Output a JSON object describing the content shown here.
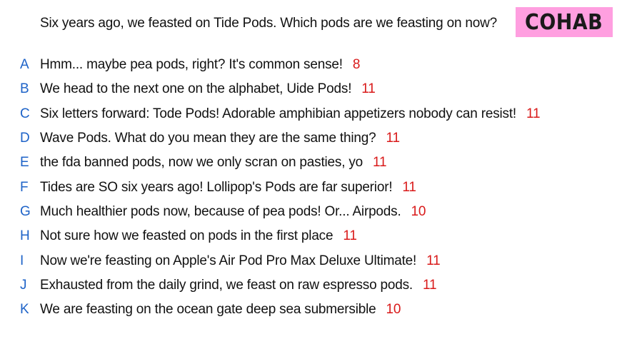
{
  "question": "Six years ago, we feasted on Tide Pods. Which pods are we feasting on now?",
  "logo": "COHAB",
  "colors": {
    "letter": "#1e63c8",
    "score": "#d91a1a",
    "logo_bg": "#ff9fe0"
  },
  "answers": [
    {
      "letter": "A",
      "text": "Hmm... maybe pea pods, right? It's common sense!",
      "score": "8"
    },
    {
      "letter": "B",
      "text": "We head to the next one on the alphabet, Uide Pods!",
      "score": "11"
    },
    {
      "letter": "C",
      "text": "Six letters forward: Tode Pods! Adorable amphibian appetizers nobody can resist!",
      "score": "11"
    },
    {
      "letter": "D",
      "text": "Wave Pods. What do you mean they are the same thing?",
      "score": "11"
    },
    {
      "letter": "E",
      "text": "the fda banned pods, now we only scran on pasties, yo",
      "score": "11"
    },
    {
      "letter": "F",
      "text": "Tides are SO six years ago! Lollipop's Pods are far superior!",
      "score": "11"
    },
    {
      "letter": "G",
      "text": "Much healthier pods now, because of pea pods! Or... Airpods.",
      "score": "10"
    },
    {
      "letter": "H",
      "text": "Not sure how we feasted on pods in the first place",
      "score": "11"
    },
    {
      "letter": "I",
      "text": "Now we're feasting on Apple's Air Pod Pro Max Deluxe Ultimate!",
      "score": "11"
    },
    {
      "letter": "J",
      "text": "Exhausted from the daily grind, we feast on raw espresso pods.",
      "score": "11"
    },
    {
      "letter": "K",
      "text": "We are feasting on the ocean gate deep sea submersible",
      "score": "10"
    }
  ]
}
